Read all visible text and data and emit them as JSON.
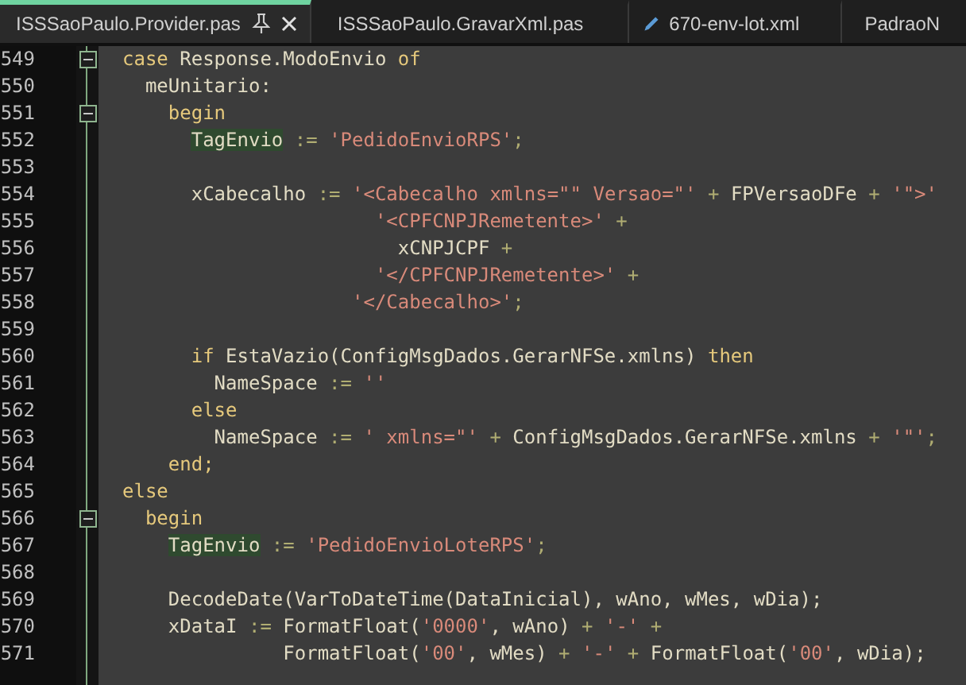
{
  "tabs": [
    {
      "label": "ISSSaoPaulo.Provider.pas",
      "kind": "source",
      "selected": true
    },
    {
      "label": "ISSSaoPaulo.GravarXml.pas",
      "kind": "source",
      "selected": false
    },
    {
      "label": "670-env-lot.xml",
      "kind": "xml",
      "selected": false
    },
    {
      "label": "PadraoN",
      "kind": "source",
      "selected": false
    }
  ],
  "lines": [
    {
      "number": "549",
      "fold": true,
      "tokens": [
        {
          "text": "case",
          "kind": "kw"
        },
        {
          "text": " Response.ModoEnvio ",
          "kind": "id"
        },
        {
          "text": "of",
          "kind": "kw"
        }
      ]
    },
    {
      "number": "550",
      "fold": false,
      "tokens": [
        {
          "text": "  meUnitario:",
          "kind": "id"
        }
      ]
    },
    {
      "number": "551",
      "fold": true,
      "tokens": [
        {
          "text": "    begin",
          "kind": "kw"
        }
      ]
    },
    {
      "number": "552",
      "fold": false,
      "tokens": [
        {
          "text": "      TagEnvio",
          "kind": "match"
        },
        {
          "text": " := ",
          "kind": "op"
        },
        {
          "text": "'PedidoEnvioRPS'",
          "kind": "str"
        },
        {
          "text": ";",
          "kind": "op"
        }
      ]
    },
    {
      "number": "553",
      "fold": false
    },
    {
      "number": "554",
      "fold": false,
      "tokens": [
        {
          "text": "      xCabecalho",
          "kind": "id"
        },
        {
          "text": " := ",
          "kind": "op"
        },
        {
          "text": "'<Cabecalho xmlns=\"\" Versao=\"'",
          "kind": "str"
        },
        {
          "text": " + ",
          "kind": "op"
        },
        {
          "text": "FPVersaoDFe",
          "kind": "id"
        },
        {
          "text": " + ",
          "kind": "op"
        },
        {
          "text": "'\">'",
          "kind": "str"
        }
      ]
    },
    {
      "number": "555",
      "fold": false,
      "tokens": [
        {
          "text": "                      '<CPFCNPJRemetente>'",
          "kind": "str"
        },
        {
          "text": " +",
          "kind": "op"
        }
      ]
    },
    {
      "number": "556",
      "fold": false,
      "tokens": [
        {
          "text": "                        xCNPJCPF",
          "kind": "id"
        },
        {
          "text": " +",
          "kind": "op"
        }
      ]
    },
    {
      "number": "557",
      "fold": false,
      "tokens": [
        {
          "text": "                      '</CPFCNPJRemetente>'",
          "kind": "str"
        },
        {
          "text": " +",
          "kind": "op"
        }
      ]
    },
    {
      "number": "558",
      "fold": false,
      "tokens": [
        {
          "text": "                    '</Cabecalho>'",
          "kind": "str"
        },
        {
          "text": ";",
          "kind": "op"
        }
      ]
    },
    {
      "number": "559",
      "fold": false
    },
    {
      "number": "560",
      "fold": false,
      "tokens": [
        {
          "text": "      if",
          "kind": "kw"
        },
        {
          "text": " EstaVazio(ConfigMsgDados.GerarNFSe.xmlns) ",
          "kind": "id"
        },
        {
          "text": "then",
          "kind": "kw"
        }
      ]
    },
    {
      "number": "561",
      "fold": false,
      "tokens": [
        {
          "text": "        NameSpace",
          "kind": "id"
        },
        {
          "text": " := ",
          "kind": "op"
        },
        {
          "text": "''",
          "kind": "str"
        }
      ]
    },
    {
      "number": "562",
      "fold": false,
      "tokens": [
        {
          "text": "      else",
          "kind": "kw"
        }
      ]
    },
    {
      "number": "563",
      "fold": false,
      "tokens": [
        {
          "text": "        NameSpace",
          "kind": "id"
        },
        {
          "text": " := ",
          "kind": "op"
        },
        {
          "text": "' xmlns=\"'",
          "kind": "str"
        },
        {
          "text": " + ",
          "kind": "op"
        },
        {
          "text": "ConfigMsgDados.GerarNFSe.xmlns",
          "kind": "id"
        },
        {
          "text": " + ",
          "kind": "op"
        },
        {
          "text": "'\"'",
          "kind": "str"
        },
        {
          "text": ";",
          "kind": "op"
        }
      ]
    },
    {
      "number": "564",
      "fold": false,
      "tokens": [
        {
          "text": "    end;",
          "kind": "kw"
        }
      ]
    },
    {
      "number": "565",
      "fold": false,
      "tokens": [
        {
          "text": "else",
          "kind": "kw"
        }
      ]
    },
    {
      "number": "566",
      "fold": true,
      "tokens": [
        {
          "text": "  begin",
          "kind": "kw"
        }
      ]
    },
    {
      "number": "567",
      "fold": false,
      "tokens": [
        {
          "text": "    TagEnvio",
          "kind": "match"
        },
        {
          "text": " := ",
          "kind": "op"
        },
        {
          "text": "'PedidoEnvioLoteRPS'",
          "kind": "str"
        },
        {
          "text": ";",
          "kind": "op"
        }
      ]
    },
    {
      "number": "568",
      "fold": false
    },
    {
      "number": "569",
      "fold": false,
      "tokens": [
        {
          "text": "    DecodeDate(VarToDateTime(DataInicial), wAno, wMes, wDia);",
          "kind": "id"
        }
      ]
    },
    {
      "number": "570",
      "fold": false,
      "tokens": [
        {
          "text": "    xDataI",
          "kind": "id"
        },
        {
          "text": " := ",
          "kind": "op"
        },
        {
          "text": "FormatFloat(",
          "kind": "id"
        },
        {
          "text": "'0000'",
          "kind": "str"
        },
        {
          "text": ", wAno)",
          "kind": "id"
        },
        {
          "text": " + ",
          "kind": "op"
        },
        {
          "text": "'-'",
          "kind": "str"
        },
        {
          "text": " +",
          "kind": "op"
        }
      ]
    },
    {
      "number": "571",
      "fold": false,
      "tokens": [
        {
          "text": "              FormatFloat(",
          "kind": "id"
        },
        {
          "text": "'00'",
          "kind": "str"
        },
        {
          "text": ", wMes)",
          "kind": "id"
        },
        {
          "text": " + ",
          "kind": "op"
        },
        {
          "text": "'-'",
          "kind": "str"
        },
        {
          "text": " + ",
          "kind": "op"
        },
        {
          "text": "FormatFloat(",
          "kind": "id"
        },
        {
          "text": "'00'",
          "kind": "str"
        },
        {
          "text": ", wDia);",
          "kind": "id"
        }
      ]
    }
  ]
}
